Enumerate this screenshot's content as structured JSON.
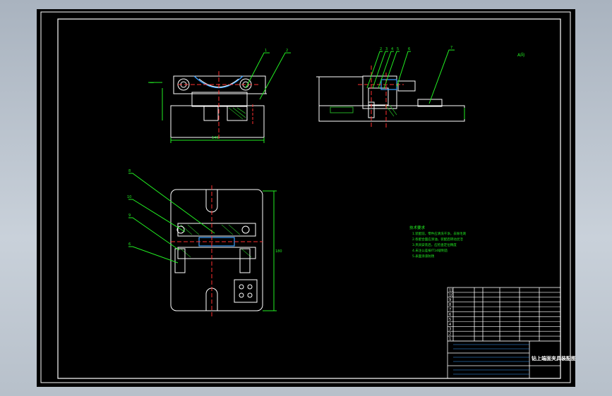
{
  "drawing": {
    "title_block": {
      "title": "钻上端面夹具装配图",
      "parts_rows": [
        {
          "no": "11"
        },
        {
          "no": "10"
        },
        {
          "no": "9"
        },
        {
          "no": "8"
        },
        {
          "no": "7"
        },
        {
          "no": "6"
        },
        {
          "no": "5"
        },
        {
          "no": "4"
        },
        {
          "no": "3"
        },
        {
          "no": "2"
        },
        {
          "no": "1"
        }
      ]
    },
    "callouts_top": [
      "1",
      "2"
    ],
    "callouts_side": [
      "2",
      "3",
      "4",
      "5",
      "6",
      "7"
    ],
    "callouts_plan": [
      "8",
      "10",
      "9",
      "6"
    ],
    "dimensions": {
      "front_width": "140",
      "plan_height": "180"
    },
    "notes": {
      "heading": "技术要求",
      "lines": [
        "1.装配前，零件应清洗干净，去除毛刺",
        "2.各配合面应涂油，装配后转动灵活",
        "3.夹具安装后，应检查定位精度",
        "4.未注公差按IT14级制造",
        "5.表面涂漆防锈"
      ]
    },
    "corner_label": "A向"
  }
}
